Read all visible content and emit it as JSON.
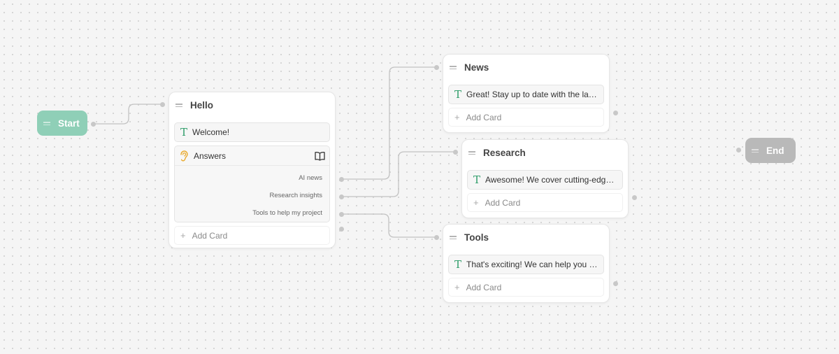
{
  "start": {
    "label": "Start",
    "color": "#8fcfb7"
  },
  "end": {
    "label": "End",
    "color": "#b9b9b9"
  },
  "hello": {
    "title": "Hello",
    "text_card": "Welcome!",
    "answers": {
      "label": "Answers",
      "icon": "ear-icon",
      "action_icon": "book-icon",
      "options": [
        "AI news",
        "Research insights",
        "Tools to help my project"
      ]
    },
    "add_card": "Add Card"
  },
  "news": {
    "title": "News",
    "text_card": "Great! Stay up to date with the late...",
    "add_card": "Add Card"
  },
  "research": {
    "title": "Research",
    "text_card": "Awesome! We cover cutting-edge ...",
    "add_card": "Add Card"
  },
  "tools": {
    "title": "Tools",
    "text_card": "That's exciting! We can help you fin...",
    "add_card": "Add Card"
  },
  "colors": {
    "accent_text_icon": "#2f9d6a",
    "answers_icon": "#e9a92b",
    "edge": "#c2c2c2"
  }
}
